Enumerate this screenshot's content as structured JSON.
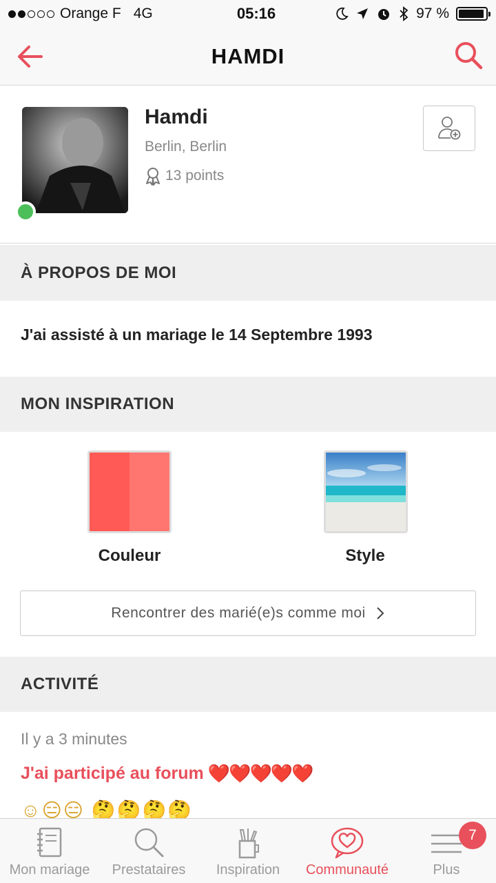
{
  "status_bar": {
    "carrier": "Orange F",
    "network": "4G",
    "time": "05:16",
    "battery": "97 %",
    "signal_bars_filled": 2,
    "signal_bars_total": 5
  },
  "nav": {
    "title": "HAMDI",
    "accent_color": "#e8505b"
  },
  "profile": {
    "name": "Hamdi",
    "location": "Berlin, Berlin",
    "points": "13 points",
    "online": true
  },
  "about": {
    "heading": "À PROPOS DE MOI",
    "text": "J'ai assisté à un mariage le 14 Septembre 1993"
  },
  "inspiration": {
    "heading": "MON INSPIRATION",
    "items": [
      {
        "label": "Couleur",
        "colors": [
          "#ff5a55",
          "#ff7671"
        ]
      },
      {
        "label": "Style"
      }
    ],
    "meet_button": "Rencontrer des marié(e)s comme moi"
  },
  "activity": {
    "heading": "ACTIVITÉ",
    "time": "Il y a 3 minutes",
    "text": "J'ai participé au forum",
    "hearts": "❤️❤️❤️❤️❤️",
    "emojis": "☺😑😑 🤔🤔🤔🤔"
  },
  "tabs": [
    {
      "label": "Mon mariage",
      "icon": "notebook-icon",
      "active": false
    },
    {
      "label": "Prestataires",
      "icon": "search-icon",
      "active": false
    },
    {
      "label": "Inspiration",
      "icon": "pencil-cup-icon",
      "active": false
    },
    {
      "label": "Communauté",
      "icon": "heart-bubble-icon",
      "active": true
    },
    {
      "label": "Plus",
      "icon": "menu-icon",
      "active": false,
      "badge": "7"
    }
  ]
}
